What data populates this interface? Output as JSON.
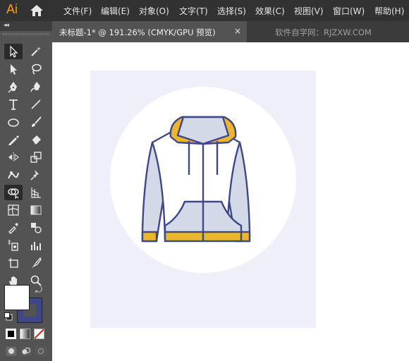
{
  "app": {
    "logo": "Ai"
  },
  "menu": [
    "文件(F)",
    "编辑(E)",
    "对象(O)",
    "文字(T)",
    "选择(S)",
    "效果(C)",
    "视图(V)",
    "窗口(W)",
    "帮助(H)"
  ],
  "document_tab": {
    "title": "未标题-1* @ 191.26% (CMYK/GPU 预览)",
    "close_label": "×"
  },
  "watermark": "软件自学网：RJZXW.COM",
  "toolbox": {
    "collapse_label": "◂◂"
  },
  "swatches": {
    "fill": "#ffffff",
    "stroke": "#3e4889"
  },
  "artwork": {
    "background": "#eeeff9",
    "circle": "#ffffff",
    "outline": "#3e4889",
    "body_fill": "#ffffff",
    "sleeve_fill": "#d3d9e6",
    "accent": "#ebb62e"
  }
}
